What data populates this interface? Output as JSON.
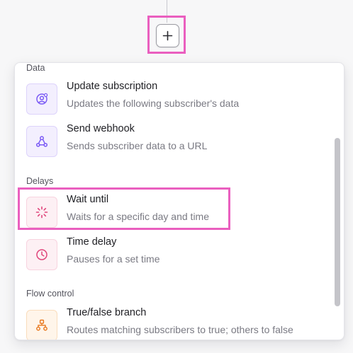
{
  "canvas": {
    "add_button_symbol": "+"
  },
  "menu": {
    "sections": [
      {
        "label": "Data",
        "items": [
          {
            "title": "Update subscription",
            "description": "Updates the following subscriber's data",
            "icon": "user-cog-icon",
            "color": "#7c5cf5"
          },
          {
            "title": "Send webhook",
            "description": "Sends subscriber data to a URL",
            "icon": "webhook-icon",
            "color": "#7c5cf5"
          }
        ]
      },
      {
        "label": "Delays",
        "items": [
          {
            "title": "Wait until",
            "description": "Waits for a specific day and time",
            "icon": "loader-icon",
            "color": "#e0467c",
            "highlighted": true
          },
          {
            "title": "Time delay",
            "description": "Pauses for a set time",
            "icon": "clock-icon",
            "color": "#e0467c"
          }
        ]
      },
      {
        "label": "Flow control",
        "items": [
          {
            "title": "True/false branch",
            "description": "Routes matching subscribers to true; others to false",
            "icon": "branch-icon",
            "color": "#e8781e"
          }
        ]
      }
    ]
  }
}
